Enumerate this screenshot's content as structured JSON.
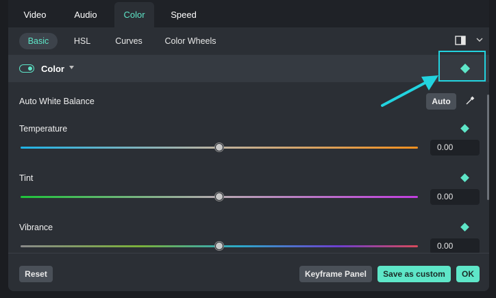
{
  "tabs": [
    {
      "label": "Video"
    },
    {
      "label": "Audio"
    },
    {
      "label": "Color"
    },
    {
      "label": "Speed"
    }
  ],
  "subtabs": [
    {
      "label": "Basic"
    },
    {
      "label": "HSL"
    },
    {
      "label": "Curves"
    },
    {
      "label": "Color Wheels"
    }
  ],
  "section": {
    "label": "Color",
    "enabled": true
  },
  "auto_white_balance": {
    "label": "Auto White Balance",
    "button": "Auto"
  },
  "sliders": [
    {
      "label": "Temperature",
      "value": "0.00",
      "level": 0.5
    },
    {
      "label": "Tint",
      "value": "0.00",
      "level": 0.5
    },
    {
      "label": "Vibrance",
      "value": "0.00",
      "level": 0.5
    }
  ],
  "footer": {
    "reset": "Reset",
    "keyframe_panel": "Keyframe Panel",
    "save_custom": "Save as custom",
    "ok": "OK"
  },
  "colors": {
    "accent": "#5ee6c8",
    "highlight": "#22d3df"
  }
}
